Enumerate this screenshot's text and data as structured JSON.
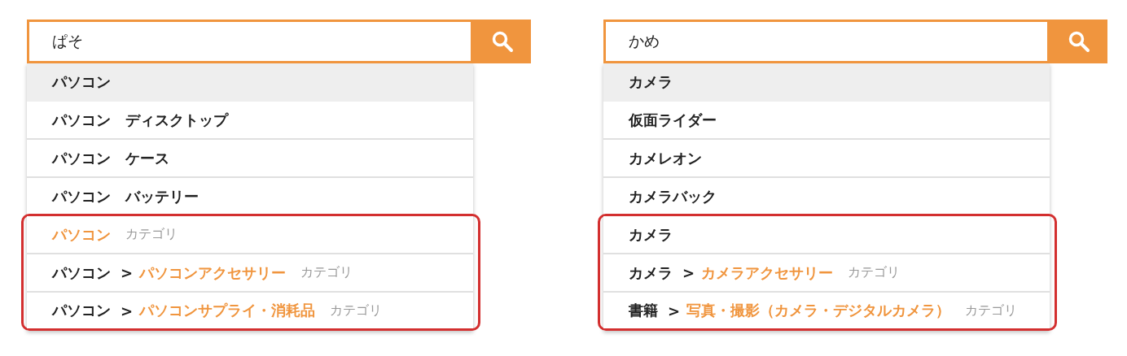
{
  "panels": [
    {
      "search": {
        "value": "ぱそ"
      },
      "suggestions": [
        {
          "kind": "keyword",
          "label": "パソコン",
          "selected": true
        },
        {
          "kind": "keyword",
          "label": "パソコン　ディスクトップ",
          "selected": false
        },
        {
          "kind": "keyword",
          "label": "パソコン　ケース",
          "selected": false
        },
        {
          "kind": "keyword",
          "label": "パソコン　バッテリー",
          "selected": false
        }
      ],
      "highlighted_suggestions": [
        {
          "kind": "category",
          "label": "パソコン",
          "tag": "カテゴリ",
          "selected": false
        },
        {
          "kind": "category",
          "parent": "パソコン",
          "separator": ">",
          "label": "パソコンアクセサリー",
          "tag": "カテゴリ",
          "selected": false
        },
        {
          "kind": "category",
          "parent": "パソコン",
          "separator": ">",
          "label": "パソコンサプライ・消耗品",
          "tag": "カテゴリ",
          "selected": false
        }
      ]
    },
    {
      "search": {
        "value": "かめ"
      },
      "suggestions": [
        {
          "kind": "keyword",
          "label": "カメラ",
          "selected": true
        },
        {
          "kind": "keyword",
          "label": "仮面ライダー",
          "selected": false
        },
        {
          "kind": "keyword",
          "label": "カメレオン",
          "selected": false
        },
        {
          "kind": "keyword",
          "label": "カメラバック",
          "selected": false
        }
      ],
      "highlighted_suggestions": [
        {
          "kind": "keyword",
          "label": "カメラ",
          "selected": false
        },
        {
          "kind": "category",
          "parent": "カメラ",
          "separator": ">",
          "label": "カメラアクセサリー",
          "tag": "カテゴリ",
          "selected": false
        },
        {
          "kind": "category",
          "parent": "書籍",
          "separator": ">",
          "label": "写真・撮影（カメラ・デジタルカメラ）",
          "tag": "カテゴリ",
          "selected": false
        }
      ]
    }
  ]
}
